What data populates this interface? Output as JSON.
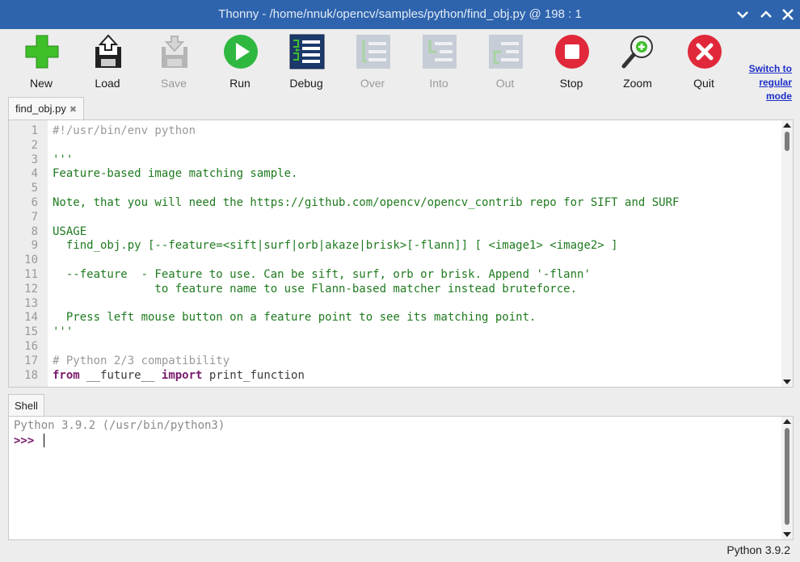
{
  "window": {
    "title": "Thonny  -  /home/nnuk/opencv/samples/python/find_obj.py  @  198 : 1"
  },
  "toolbar": {
    "buttons": [
      {
        "label": "New",
        "icon": "new-file-icon",
        "enabled": true
      },
      {
        "label": "Load",
        "icon": "load-icon",
        "enabled": true
      },
      {
        "label": "Save",
        "icon": "save-icon",
        "enabled": false
      },
      {
        "label": "Run",
        "icon": "run-icon",
        "enabled": true
      },
      {
        "label": "Debug",
        "icon": "debug-icon",
        "enabled": true
      },
      {
        "label": "Over",
        "icon": "step-over-icon",
        "enabled": false
      },
      {
        "label": "Into",
        "icon": "step-into-icon",
        "enabled": false
      },
      {
        "label": "Out",
        "icon": "step-out-icon",
        "enabled": false
      },
      {
        "label": "Stop",
        "icon": "stop-icon",
        "enabled": true
      },
      {
        "label": "Zoom",
        "icon": "zoom-icon",
        "enabled": true
      },
      {
        "label": "Quit",
        "icon": "quit-icon",
        "enabled": true
      }
    ],
    "switch_mode": [
      "Switch to",
      "regular",
      "mode"
    ]
  },
  "editor": {
    "tab_label": "find_obj.py",
    "lines": [
      {
        "n": "1",
        "text": "#!/usr/bin/env python",
        "style": "com"
      },
      {
        "n": "2",
        "text": "",
        "style": "def"
      },
      {
        "n": "3",
        "text": "'''",
        "style": "str"
      },
      {
        "n": "4",
        "text": "Feature-based image matching sample.",
        "style": "str"
      },
      {
        "n": "5",
        "text": "",
        "style": "str"
      },
      {
        "n": "6",
        "text": "Note, that you will need the https://github.com/opencv/opencv_contrib repo for SIFT and SURF",
        "style": "str"
      },
      {
        "n": "7",
        "text": "",
        "style": "str"
      },
      {
        "n": "8",
        "text": "USAGE",
        "style": "str"
      },
      {
        "n": "9",
        "text": "  find_obj.py [--feature=<sift|surf|orb|akaze|brisk>[-flann]] [ <image1> <image2> ]",
        "style": "str"
      },
      {
        "n": "10",
        "text": "",
        "style": "str"
      },
      {
        "n": "11",
        "text": "  --feature  - Feature to use. Can be sift, surf, orb or brisk. Append '-flann'",
        "style": "str"
      },
      {
        "n": "12",
        "text": "               to feature name to use Flann-based matcher instead bruteforce.",
        "style": "str"
      },
      {
        "n": "13",
        "text": "",
        "style": "str"
      },
      {
        "n": "14",
        "text": "  Press left mouse button on a feature point to see its matching point.",
        "style": "str"
      },
      {
        "n": "15",
        "text": "'''",
        "style": "str"
      },
      {
        "n": "16",
        "text": "",
        "style": "def"
      },
      {
        "n": "17",
        "text": "# Python 2/3 compatibility",
        "style": "com"
      },
      {
        "n": "18",
        "text": "from __future__ import print_function",
        "style": "kwline"
      }
    ]
  },
  "shell": {
    "tab_label": "Shell",
    "banner": "Python 3.9.2 (/usr/bin/python3)",
    "prompt": ">>>"
  },
  "status": {
    "interpreter": "Python 3.9.2"
  },
  "colors": {
    "titlebar": "#2e64ad",
    "string": "#1f7a1f",
    "comment": "#9a9a9a",
    "keyword": "#7a1a6a",
    "link": "#1b2fc7"
  }
}
